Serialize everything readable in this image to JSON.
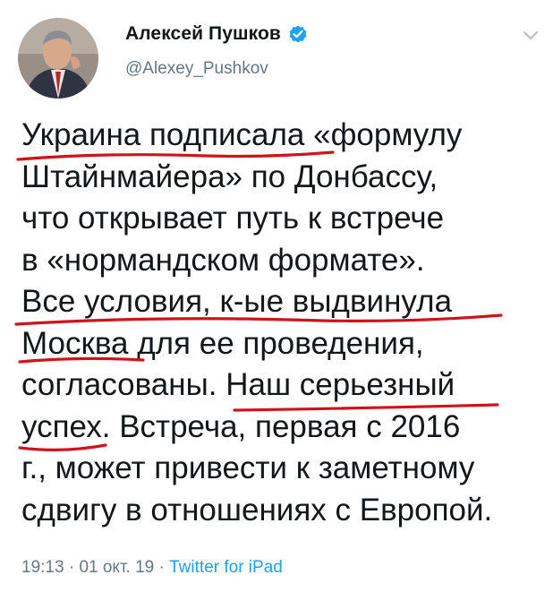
{
  "tweet": {
    "author": {
      "name": "Алексей Пушков",
      "handle": "@Alexey_Pushkov"
    },
    "body_lines": [
      "Украина подписала «формулу",
      "Штайнмайера» по Донбассу,",
      "что открывает путь к встрече",
      "в «нормандском формате».",
      "Все условия, к-ые выдвинула",
      "Москва для ее проведения,",
      "согласованы. Наш серьезный",
      "успех. Встреча, первая с 2016",
      "г., может привести к заметному",
      "сдвигу в отношениях с Европой."
    ],
    "meta": {
      "time": "19:13",
      "sep1": " · ",
      "date": "01 окт. 19",
      "sep2": " · ",
      "source": "Twitter for iPad"
    }
  },
  "colors": {
    "text": "#14171a",
    "secondary": "#657786",
    "link": "#1da1f2",
    "verified": "#1da1f2",
    "underline": "#d0121b"
  },
  "icons": {
    "verified": "verified-badge-icon",
    "caret": "chevron-down-icon"
  }
}
